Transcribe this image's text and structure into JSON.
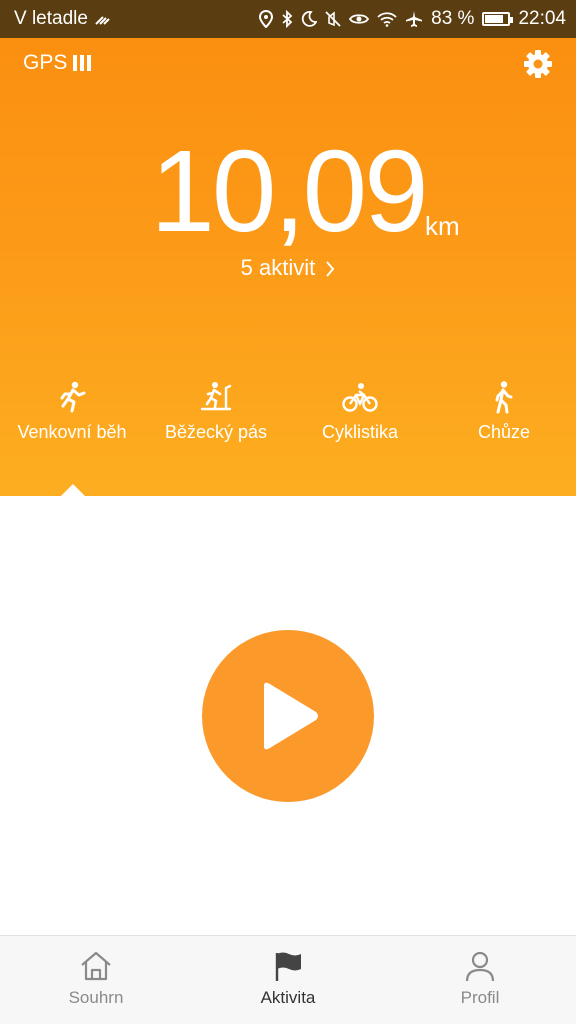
{
  "status_bar": {
    "carrier": "V letadle",
    "battery_percent": "83 %",
    "time": "22:04",
    "battery_level": 0.83,
    "icons": [
      "location-icon",
      "bluetooth-icon",
      "moon-icon",
      "mute-icon",
      "eye-icon",
      "wifi-icon",
      "airplane-icon",
      "battery-icon"
    ]
  },
  "header": {
    "gps_label": "GPS",
    "settings_icon": "gear-icon"
  },
  "summary": {
    "distance_value": "10,09",
    "distance_unit": "km",
    "activities_link": "5 aktivit"
  },
  "modes": [
    {
      "label": "Venkovní běh",
      "icon": "running-icon",
      "selected": true
    },
    {
      "label": "Běžecký pás",
      "icon": "treadmill-icon",
      "selected": false
    },
    {
      "label": "Cyklistika",
      "icon": "bicycle-icon",
      "selected": false
    },
    {
      "label": "Chůze",
      "icon": "walking-icon",
      "selected": false
    }
  ],
  "play_button": {
    "icon": "play-icon"
  },
  "bottom_nav": [
    {
      "label": "Souhrn",
      "icon": "home-icon",
      "active": false
    },
    {
      "label": "Aktivita",
      "icon": "flag-icon",
      "active": true
    },
    {
      "label": "Profil",
      "icon": "person-icon",
      "active": false
    }
  ],
  "colors": {
    "accent": "#fb9a2a",
    "header_top": "#fb8f10",
    "header_bottom": "#fdae20",
    "status_bar": "#5b3d12"
  }
}
